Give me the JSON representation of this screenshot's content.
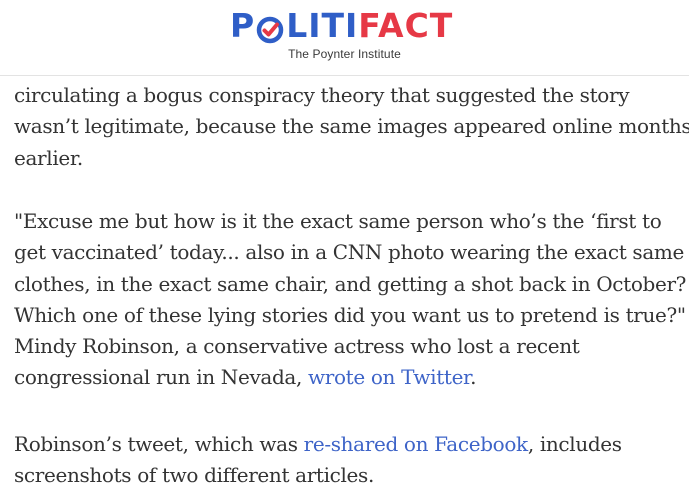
{
  "header": {
    "logo": {
      "part1": "P",
      "part2": "LITI",
      "part3": "FACT",
      "colors": {
        "blue": "#2f5ec7",
        "red": "#e63946"
      }
    },
    "tagline": "The Poynter Institute"
  },
  "article": {
    "p1": {
      "lines": [
        "circulating a bogus conspiracy theory that suggested the story",
        "wasn’t legitimate, because the same images appeared online months",
        "earlier."
      ]
    },
    "p2": {
      "lines": [
        "\"Excuse me but how is it the exact same person who’s the ‘first to",
        "get vaccinated’ today... also in a CNN photo wearing the exact same",
        "clothes, in the exact same chair, and getting a shot back in October?",
        "Which one of these lying stories did you want us to pretend is true?\"",
        "Mindy Robinson, a conservative actress who lost a recent",
        "congressional run in Nevada, "
      ],
      "link_text": "wrote on Twitter",
      "after_link": "."
    },
    "p3": {
      "line1_before": "Robinson’s tweet, which was ",
      "link_text": "re-shared on Facebook",
      "line1_after": ", includes",
      "line2": "screenshots of two different articles."
    }
  }
}
